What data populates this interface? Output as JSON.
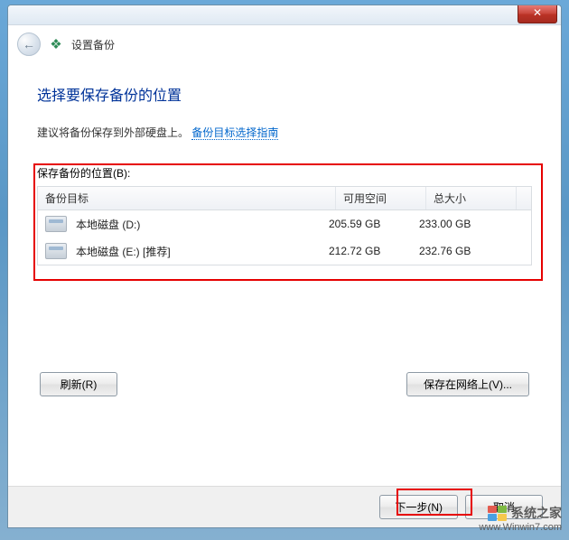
{
  "header": {
    "title": "设置备份"
  },
  "page": {
    "title": "选择要保存备份的位置",
    "hint_text": "建议将备份保存到外部硬盘上。",
    "hint_link": "备份目标选择指南"
  },
  "section": {
    "label": "保存备份的位置(B):"
  },
  "table": {
    "columns": {
      "name": "备份目标",
      "free": "可用空间",
      "total": "总大小"
    },
    "rows": [
      {
        "name": "本地磁盘 (D:)",
        "free": "205.59 GB",
        "total": "233.00 GB"
      },
      {
        "name": "本地磁盘 (E:) [推荐]",
        "free": "212.72 GB",
        "total": "232.76 GB"
      }
    ]
  },
  "buttons": {
    "refresh": "刷新(R)",
    "save_network": "保存在网络上(V)...",
    "next": "下一步(N)",
    "cancel": "取消"
  },
  "watermark": {
    "line1": "系统之家",
    "line2": "www.Winwin7.com"
  }
}
